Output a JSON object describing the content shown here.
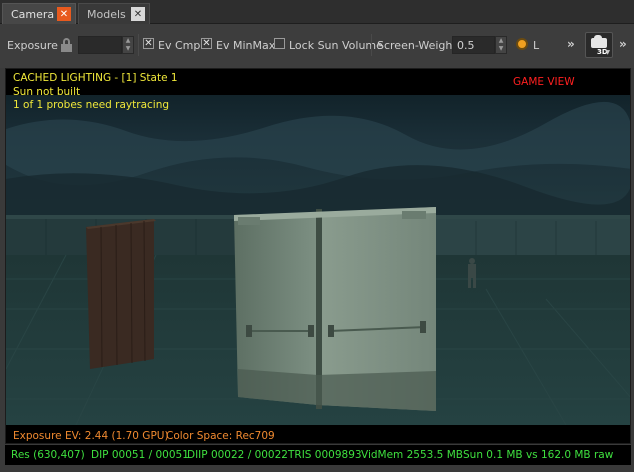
{
  "tabs": [
    {
      "label": "Camera",
      "close": "✕"
    },
    {
      "label": "Models",
      "close": "✕"
    }
  ],
  "toolbar": {
    "exposure_label": "Exposure",
    "exposure_value": "",
    "ev_cmp_label": "Ev Cmp",
    "ev_cmp_checked": "✕",
    "ev_minmax_label": "Ev MinMax",
    "ev_minmax_checked": "✕",
    "lock_sun_label": "Lock Sun Volume",
    "lock_sun_checked": "",
    "screen_weight_label": "Screen-Weight",
    "screen_weight_value": "0.5",
    "radio_label": "L",
    "more_1": "»",
    "more_2": "»",
    "camera_mode": "3D",
    "accent": "#f0a020"
  },
  "viewport": {
    "line1": "CACHED LIGHTING - [1] State 1",
    "line2": "Sun not built",
    "line3": "1 of 1 probes need raytracing",
    "game_view": "GAME VIEW",
    "exposure_ev": "Exposure EV: 2.44 (1.70 GPU)",
    "color_space": "Color Space: Rec709"
  },
  "status": {
    "res": "Res (630,407)",
    "dip": "DIP 00051 / 00051",
    "diip": "DIIP 00022 / 00022",
    "tris": "TRIS 0009893",
    "vidmem": "VidMem 2553.5 MB",
    "sun": "Sun 0.1 MB vs 162.0 MB raw",
    "color": "#3fe03f"
  }
}
